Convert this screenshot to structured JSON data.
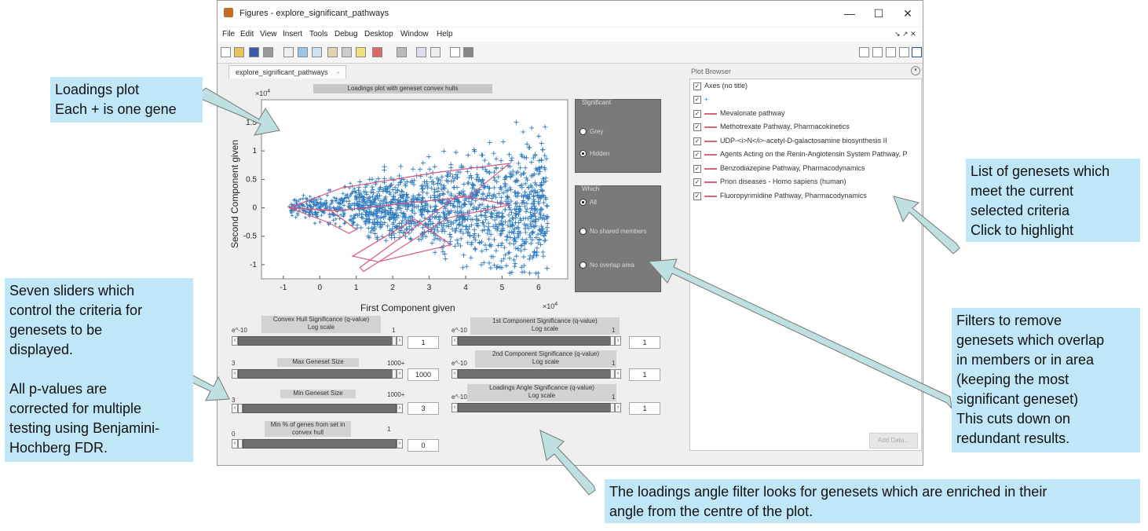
{
  "window": {
    "title": "Figures - explore_significant_pathways",
    "controls": [
      "—",
      "☐",
      "✕"
    ],
    "menu": [
      "File",
      "Edit",
      "View",
      "Insert",
      "Tools",
      "Debug",
      "Desktop",
      "Window",
      "Help"
    ],
    "tab": "explore_significant_pathways"
  },
  "plot": {
    "title": "Loadings plot with geneset convex hulls",
    "exponent_y": "×10",
    "exponent_y_sup": "4",
    "exponent_x": "×10",
    "exponent_x_sup": "4"
  },
  "chart_data": {
    "type": "scatter",
    "title": "Loadings plot with geneset convex hulls",
    "xlabel": "First Component given",
    "ylabel": "Second Component given",
    "xticks": [
      "-1",
      "0",
      "1",
      "2",
      "3",
      "4",
      "5",
      "6"
    ],
    "yticks": [
      "1.5",
      "1",
      "0.5",
      "0",
      "-0.5",
      "-1"
    ],
    "xlim": [
      -1.6,
      6.8
    ],
    "ylim": [
      -1.25,
      1.9
    ],
    "marker": "+",
    "marker_color": "#2e7bbf",
    "hull_color": "#d9577a"
  },
  "panel_significant": {
    "title": "Significant",
    "options": [
      "Grey",
      "Hidden"
    ],
    "selected": "Hidden"
  },
  "panel_which": {
    "title": "Which",
    "options": [
      "All",
      "No shared members",
      "No overlap area"
    ],
    "selected": "All"
  },
  "sliders": {
    "convex_hull": {
      "label": "Convex Hull Significance (q-value)",
      "sublabel": "Log scale",
      "min": "e^-10",
      "max": "1",
      "value": "1"
    },
    "max_geneset": {
      "label": "Max Geneset Size",
      "sublabel": "",
      "min": "3",
      "max": "1000+",
      "value": "1000"
    },
    "min_geneset": {
      "label": "Min Geneset Size",
      "sublabel": "",
      "min": "3",
      "max": "1000+",
      "value": "3"
    },
    "min_pct": {
      "label": "Min % of genes from set in",
      "sublabel": "convex hull",
      "min": "0",
      "max": "1",
      "value": "0"
    },
    "first_component": {
      "label": "1st Component Significance (q-value)",
      "sublabel": "Log scale",
      "min": "e^-10",
      "max": "1",
      "value": "1"
    },
    "second_component": {
      "label": "2nd Component Significance (q-value)",
      "sublabel": "Log scale",
      "min": "e^-10",
      "max": "1",
      "value": "1"
    },
    "loadings_angle": {
      "label": "Loadings Angle Significance (q-value)",
      "sublabel": "Log scale",
      "min": "e^-10",
      "max": "1",
      "value": "1"
    }
  },
  "plot_browser": {
    "title": "Plot Browser",
    "items": [
      "Axes (no title)",
      "",
      "Mevalonate pathway",
      "Methotrexate Pathway, Pharmacokinetics",
      "UDP-<i>N</i>-acetyl-D-galactosamine biosynthesis II",
      "Agents Acting on the Renin-Angiotensin System Pathway, P",
      "Benzodiazepine Pathway, Pharmacodynamics",
      "Prion diseases - Homo sapiens (human)",
      "Fluoropyrimidine Pathway, Pharmacodynamics"
    ],
    "button": "Add Data..."
  },
  "annotations": {
    "loadings": "Loadings plot\nEach + is one gene",
    "genesets": "List of genesets which\nmeet the current\nselected criteria\nClick to highlight",
    "sliders": "Seven sliders which\ncontrol the criteria for\ngenesets to be\ndisplayed.\n\nAll p-values are\ncorrected for multiple\ntesting using Benjamini-\nHochberg FDR.",
    "filters": "Filters to remove\ngenesets which overlap\nin members or in area\n(keeping the most\nsignificant geneset)\nThis cuts down on\nredundant results.",
    "angle": "The loadings angle filter looks for genesets which are enriched in their\nangle from the centre of the plot."
  },
  "colors": {
    "annotation_bg": "#bfe7f7",
    "arrow_fill": "#bfe0e0",
    "panel_bg": "#7a7a7a",
    "marker": "#2e7bbf",
    "hull": "#d9577a"
  }
}
